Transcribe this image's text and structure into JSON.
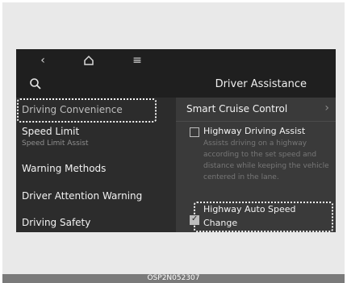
{
  "topbar": {
    "back_glyph": "‹",
    "home_icon": "home-icon",
    "menu_glyph": "≡"
  },
  "header": {
    "search_icon": "search-icon",
    "title": "Driver Assistance"
  },
  "left_menu": {
    "items": [
      {
        "label": "Driving Convenience"
      },
      {
        "label": "Speed Limit",
        "sub": "Speed Limit Assist"
      },
      {
        "label": "Warning Methods"
      },
      {
        "label": "Driver Attention Warning"
      },
      {
        "label": "Driving Safety"
      }
    ]
  },
  "right_panel": {
    "section_title": "Smart Cruise Control",
    "chevron": "›",
    "options": [
      {
        "label": "Highway Driving Assist",
        "checked": false,
        "description": "Assists driving on a highway according to the set speed and distance while keeping the vehicle centered in the lane."
      },
      {
        "label_line1": "Highway Auto Speed",
        "label_line2": "Change",
        "checked": true
      }
    ]
  },
  "caption": {
    "text": "OSP2N052307"
  },
  "colors": {
    "screen_bg": "#1f1f1f",
    "left_panel_bg": "#2c2c2c",
    "right_panel_bg": "#3a3a3a",
    "text": "#f2f2f2",
    "muted_text": "#777777",
    "caption_bg": "#7a7a7a"
  }
}
